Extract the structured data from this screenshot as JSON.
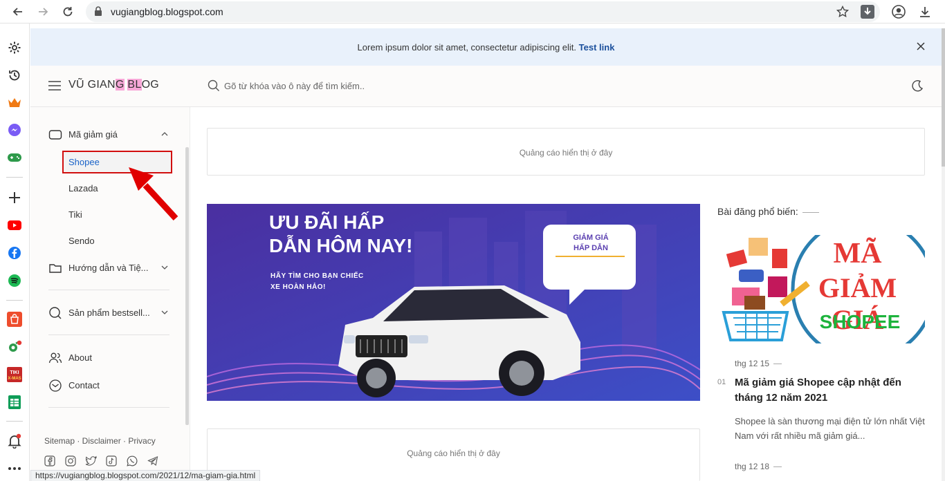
{
  "browser": {
    "url": "vugiangblog.blogspot.com",
    "status_url": "https://vugiangblog.blogspot.com/2021/12/ma-giam-gia.html",
    "sidebar_icons": [
      "gear-icon",
      "history-icon",
      "crown-icon",
      "messenger-icon",
      "gamepad-icon",
      "add-icon",
      "youtube-icon",
      "facebook-icon",
      "spotify-icon",
      "shopee-app-icon",
      "extension-icon",
      "tiki-xmas-icon",
      "sheets-icon",
      "bell-icon",
      "more-icon"
    ]
  },
  "announcement": {
    "text": "Lorem ipsum dolor sit amet, consectetur adipiscing elit.",
    "link": "Test link"
  },
  "header": {
    "title_pre": "VŨ GIAN",
    "title_hl1": "G",
    "title_mid": " ",
    "title_hl2": "BL",
    "title_post": "OG",
    "search_placeholder": "Gõ từ khóa vào ô này để tìm kiếm.."
  },
  "sidebar": {
    "categories": {
      "label": "Mã giảm giá",
      "items": [
        "Shopee",
        "Lazada",
        "Tiki",
        "Sendo"
      ]
    },
    "guides_label": "Hướng dẫn và Tiệ...",
    "bestseller_label": "Sản phẩm bestsell...",
    "about_label": "About",
    "contact_label": "Contact",
    "footer_links": "Sitemap · Disclaimer · Privacy"
  },
  "main": {
    "ad_text_top": "Quảng cáo hiển thị ở đây",
    "ad_text_bottom": "Quảng cáo hiển thị ở đây",
    "hero": {
      "headline_1": "ƯU ĐÃI HẤP",
      "headline_2": "DẪN HÔM NAY!",
      "subline_1": "HÃY TÌM CHO BẠN CHIẾC",
      "subline_2": "XE HOÀN HẢO!",
      "bubble_1": "GIẢM GIÁ",
      "bubble_2": "HẤP DẪN"
    }
  },
  "popular": {
    "title": "Bài đăng phổ biến:",
    "image_text_1": "MÃ",
    "image_text_2": "GIẢM GIÁ",
    "image_text_3": "SHOPEE",
    "posts": [
      {
        "date": "thg 12 15",
        "number": "01",
        "title": "Mã giảm giá Shopee cập nhật đến tháng 12 năm 2021",
        "excerpt": "Shopee là sàn thương mại điện tử lớn nhất Việt Nam với rất nhiều mã giảm giá..."
      },
      {
        "date": "thg 12 18"
      }
    ]
  },
  "colors": {
    "accent_link": "#1a63c8",
    "highlight_box": "#d10e0e",
    "announce_bg": "#e9f1fb"
  }
}
